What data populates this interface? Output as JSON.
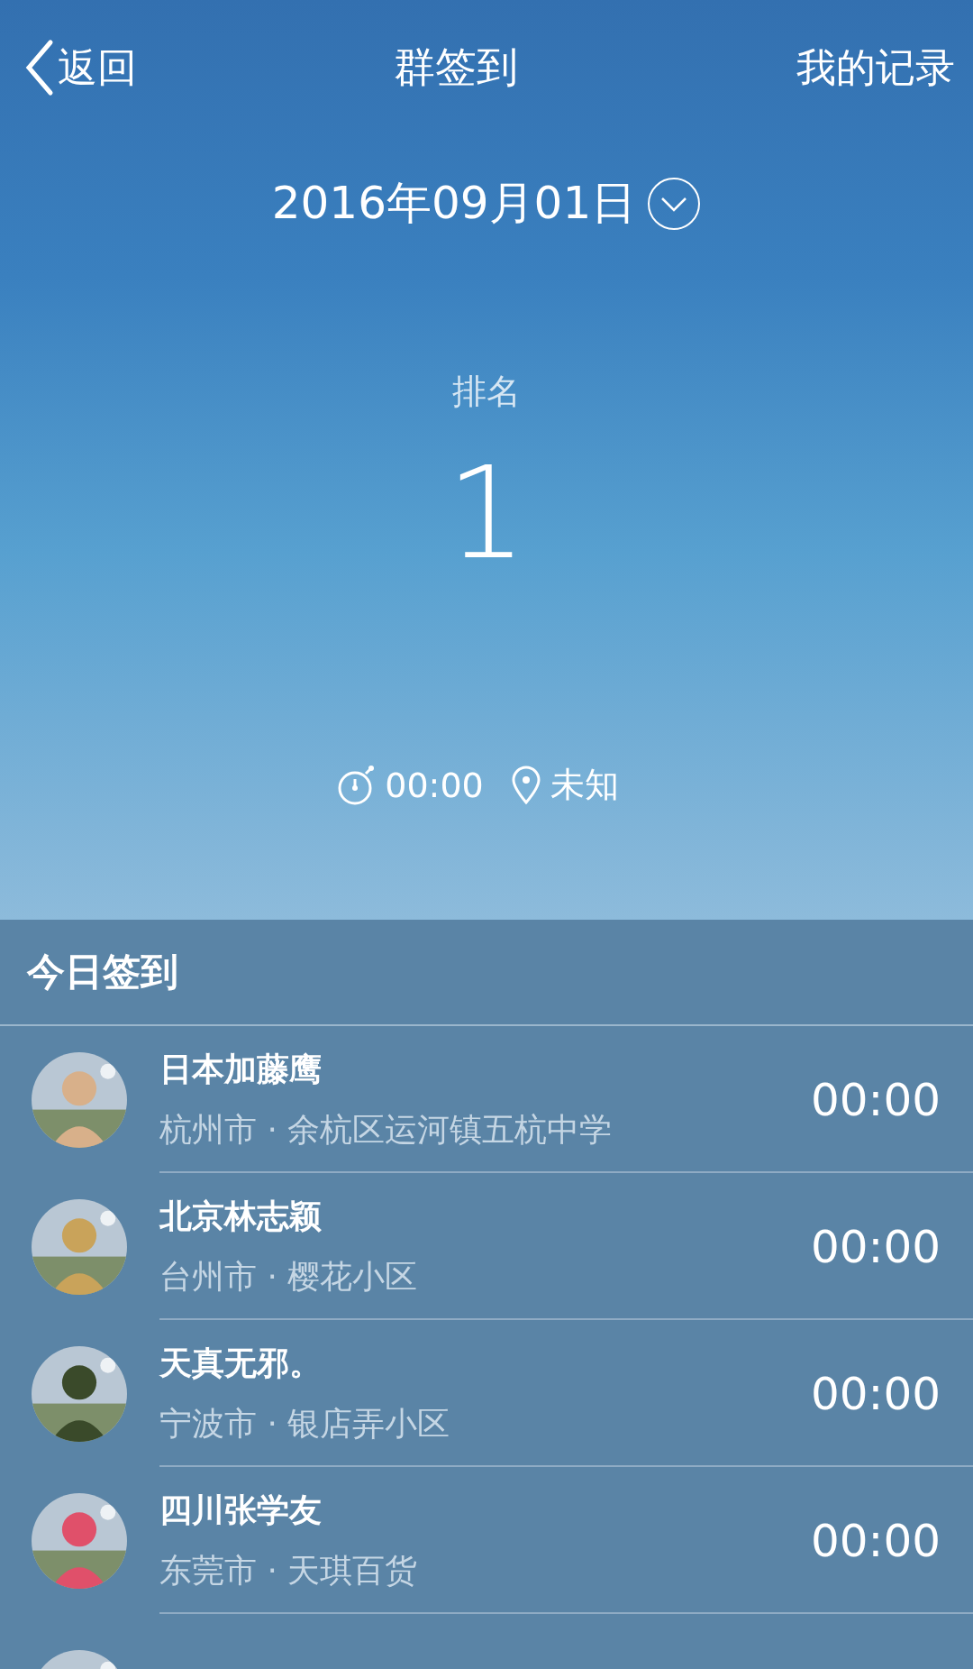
{
  "nav": {
    "back": "返回",
    "title": "群签到",
    "right": "我的记录"
  },
  "date": "2016年09月01日",
  "rank": {
    "label": "排名",
    "value": "1"
  },
  "checkin": {
    "time": "00:00",
    "place": "未知"
  },
  "today": {
    "title": "今日签到",
    "rows": [
      {
        "name": "日本加藤鹰",
        "location": "杭州市 · 余杭区运河镇五杭中学",
        "time": "00:00",
        "avatar": {
          "kind": "picture"
        }
      },
      {
        "name": "北京林志颖",
        "location": "台州市 · 樱花小区",
        "time": "00:00",
        "avatar": {
          "kind": "picture"
        }
      },
      {
        "name": "天真无邪。",
        "location": "宁波市 · 银店弄小区",
        "time": "00:00",
        "avatar": {
          "kind": "picture"
        }
      },
      {
        "name": "四川张学友",
        "location": "东莞市 · 天琪百货",
        "time": "00:00",
        "avatar": {
          "kind": "picture"
        }
      },
      {
        "avatar": {
          "kind": "picture"
        }
      }
    ]
  }
}
